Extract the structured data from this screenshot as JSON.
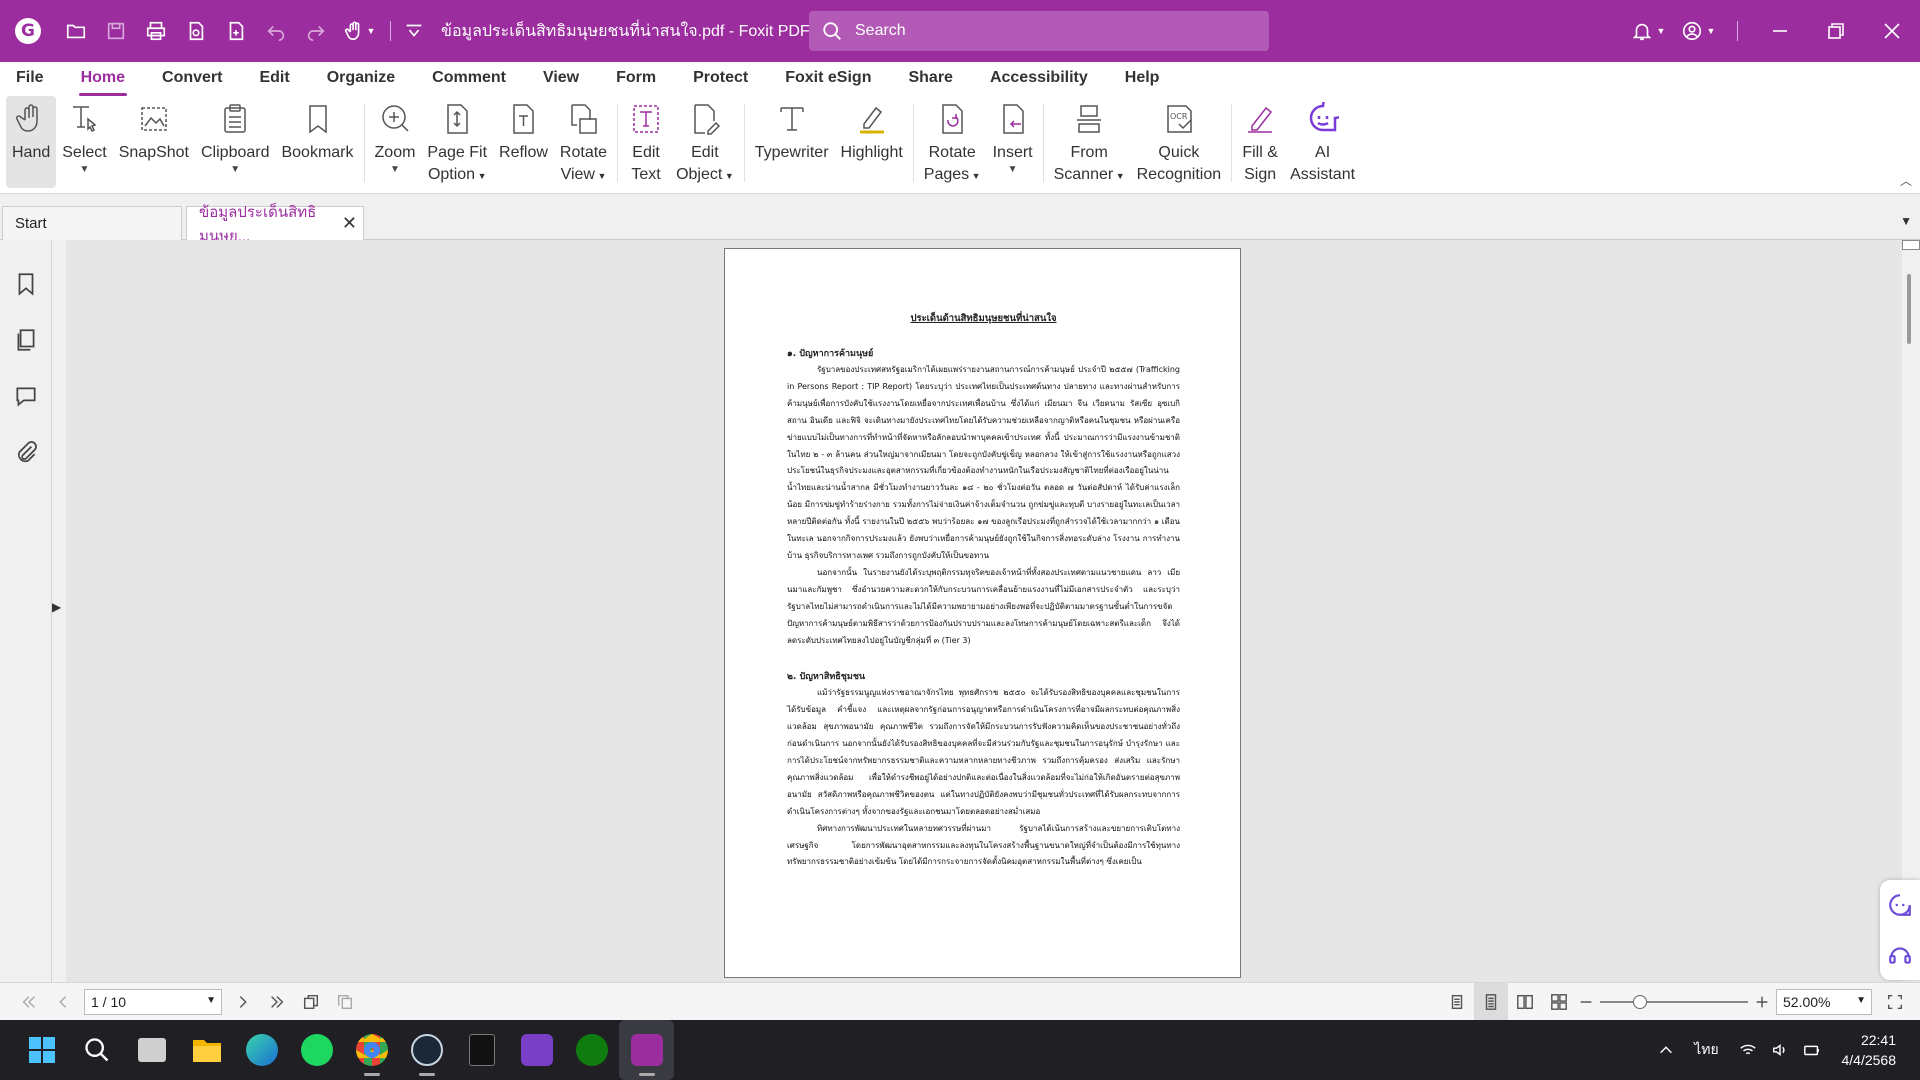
{
  "titlebar": {
    "title": "ข้อมูลประเด็นสิทธิมนุษยชนที่น่าสนใจ.pdf - Foxit PDF Editor",
    "search_placeholder": "Search",
    "accent": "#9b2d9f"
  },
  "menu": [
    "File",
    "Home",
    "Convert",
    "Edit",
    "Organize",
    "Comment",
    "View",
    "Form",
    "Protect",
    "Foxit eSign",
    "Share",
    "Accessibility",
    "Help"
  ],
  "ribbon": {
    "hand": "Hand",
    "select": "Select",
    "snapshot": "SnapShot",
    "clipboard": "Clipboard",
    "bookmark": "Bookmark",
    "zoom": "Zoom",
    "page_fit_1": "Page Fit",
    "page_fit_2": "Option",
    "reflow": "Reflow",
    "rotate_view_1": "Rotate",
    "rotate_view_2": "View",
    "edit_text_1": "Edit",
    "edit_text_2": "Text",
    "edit_object_1": "Edit",
    "edit_object_2": "Object",
    "typewriter": "Typewriter",
    "highlight": "Highlight",
    "rotate_pages_1": "Rotate",
    "rotate_pages_2": "Pages",
    "insert": "Insert",
    "from_scanner_1": "From",
    "from_scanner_2": "Scanner",
    "quick_recognition_1": "Quick",
    "quick_recognition_2": "Recognition",
    "fill_sign_1": "Fill &",
    "fill_sign_2": "Sign",
    "ai_assistant_1": "AI",
    "ai_assistant_2": "Assistant"
  },
  "tabs": {
    "start": "Start",
    "doc": "ข้อมูลประเด็นสิทธิมนุษย..."
  },
  "document": {
    "title": "ประเด็นด้านสิทธิมนุษยชนที่น่าสนใจ",
    "h1": "๑. ปัญหาการค้ามนุษย์",
    "p1": "รัฐบาลของประเทศสหรัฐอเมริกาได้เผยแพร่รายงานสถานการณ์การค้ามนุษย์ ประจำปี ๒๕๕๗ (Trafficking in Persons Report : TIP Report) โดยระบุว่า ประเทศไทยเป็นประเทศต้นทาง ปลายทาง และทางผ่านสำหรับการค้ามนุษย์เพื่อการบังคับใช้แรงงานโดยเหยื่อจากประเทศเพื่อนบ้าน ซึ่งได้แก่ เมียนมา จีน เวียดนาม รัสเซีย อุซเบกิสถาน อินเดีย และฟิจิ จะเดินทางมายังประเทศไทยโดยได้รับความช่วยเหลือจากญาติหรือคนในชุมชน หรือผ่านเครือข่ายแบบไม่เป็นทางการที่ทำหน้าที่จัดหาหรือลักลอบนำพาบุคคลเข้าประเทศ ทั้งนี้ ประมาณการว่ามีแรงงานข้ามชาติในไทย ๒ - ๓ ล้านคน ส่วนใหญ่มาจากเมียนมา โดยจะถูกบังคับขู่เข็ญ หลอกลวง ให้เข้าสู่การใช้แรงงานหรือถูกแสวงประโยชน์ในธุรกิจประมงและอุตสาหกรรมที่เกี่ยวข้องต้องทำงานหนักในเรือประมงสัญชาติไทยที่ต่องเรืออยู่ในน่านน้ำไทยและน่านน้ำสากล มีชั่วโมงทำงานยาววันละ ๑๘ - ๒๐ ชั่วโมงต่อวัน ตลอด ๗ วันต่อสัปดาห์ ได้รับค่าแรงเล็กน้อย มีการข่มขู่ทำร้ายร่างกาย รวมทั้งการไม่จ่ายเงินค่าจ้างเต็มจำนวน ถูกข่มขู่และทุบตี บางรายอยู่ในทะเลเป็นเวลาหลายปีติดต่อกัน ทั้งนี้ รายงานในปี ๒๕๕๖ พบว่าร้อยละ ๑๗ ของลูกเรือประมงที่ถูกสำรวจได้ใช้เวลามากกว่า ๑ เดือนในทะเล นอกจากกิจการประมงแล้ว ยังพบว่าเหยื่อการค้ามนุษย์ยังถูกใช้ในกิจการสิ่งทอระดับล่าง โรงงาน การทำงานบ้าน ธุรกิจบริการทางเพศ รวมถึงการถูกบังคับให้เป็นขอทาน",
    "p2": "นอกจากนั้น ในรายงานยังได้ระบุพฤติกรรมทุจริตของเจ้าหน้าที่ทั้งสองประเทศตามแนวชายแดน ลาว เมียนมาและกัมพูชา ซึ่งอำนวยความสะดวกให้กับกระบวนการเคลื่อนย้ายแรงงานที่ไม่มีเอกสารประจำตัว และระบุว่า รัฐบาลไทยไม่สามารถดำเนินการและไม่ได้มีความพยายามอย่างเพียงพอที่จะปฏิบัติตามมาตรฐานขั้นต่ำในการขจัดปัญหาการค้ามนุษย์ตามพิธีสารว่าด้วยการป้องกันปราบปรามและลงโทษการค้ามนุษย์โดยเฉพาะสตรีและเด็ก จึงได้ลดระดับประเทศไทยลงไปอยู่ในบัญชีกลุ่มที่ ๓ (Tier 3)",
    "h2": "๒. ปัญหาสิทธิชุมชน",
    "p3": "แม้ว่ารัฐธรรมนูญแห่งราชอาณาจักรไทย พุทธศักราช ๒๕๕๐ จะได้รับรองสิทธิของบุคคลและชุมชนในการได้รับข้อมูล คำชี้แจง และเหตุผลจากรัฐก่อนการอนุญาตหรือการดำเนินโครงการที่อาจมีผลกระทบต่อคุณภาพสิ่งแวดล้อม สุขภาพอนามัย คุณภาพชีวิต รวมถึงการจัดให้มีกระบวนการรับฟังความคิดเห็นของประชาชนอย่างทั่วถึงก่อนดำเนินการ นอกจากนั้นยังได้รับรองสิทธิของบุคคลที่จะมีส่วนร่วมกับรัฐและชุมชนในการอนุรักษ์ บำรุงรักษา และการได้ประโยชน์จากทรัพยากรธรรมชาติและความหลากหลายทางชีวภาพ รวมถึงการคุ้มครอง ส่งเสริม และรักษาคุณภาพสิ่งแวดล้อม เพื่อให้ดำรงชีพอยู่ได้อย่างปกติและต่อเนื่องในสิ่งแวดล้อมที่จะไม่ก่อให้เกิดอันตรายต่อสุขภาพอนามัย สวัสดิภาพหรือคุณภาพชีวิตของตน แต่ในทางปฏิบัติยังคงพบว่ามีชุมชนทั่วประเทศที่ได้รับผลกระทบจากการดำเนินโครงการต่างๆ ทั้งจากของรัฐและเอกชนมาโดยตลอดอย่างสม่ำเสมอ",
    "p4": "ทิศทางการพัฒนาประเทศในหลายทศวรรษที่ผ่านมา รัฐบาลได้เน้นการสร้างและขยายการเติบโตทางเศรษฐกิจ โดยการพัฒนาอุตสาหกรรมและลงทุนในโครงสร้างพื้นฐานขนาดใหญ่ที่จำเป็นต้องมีการใช้ทุนทางทรัพยากรธรรมชาติอย่างเข้มข้น โดยได้มีการกระจายการจัดตั้งนิคมอุตสาหกรรมในพื้นที่ต่างๆ ซึ่งเคยเป็น"
  },
  "statusbar": {
    "page": "1 / 10",
    "zoom": "52.00%",
    "zoom_level_fraction": 0.27
  },
  "taskbar": {
    "apps": [
      "start",
      "search",
      "task-view",
      "file-explorer",
      "edge",
      "spotify",
      "chrome",
      "steam",
      "epic-games",
      "app-purple",
      "xbox",
      "foxit-pdf"
    ],
    "lang": "ไทย",
    "time": "22:41",
    "date": "4/4/2568"
  }
}
